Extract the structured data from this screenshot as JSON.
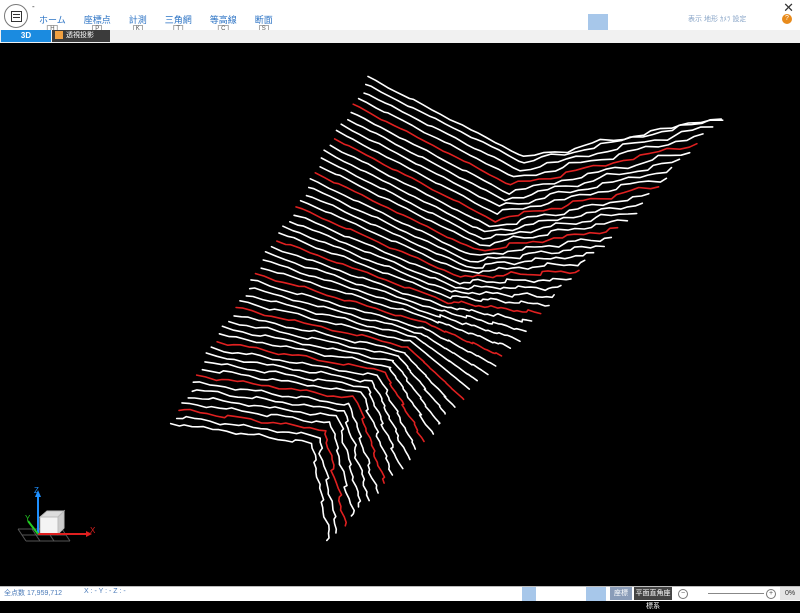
{
  "titlebar": {
    "qat_text": "-",
    "close_glyph": "✕",
    "tabs": [
      {
        "label": "ホーム",
        "key": "H"
      },
      {
        "label": "座標点",
        "key": "P"
      },
      {
        "label": "計測",
        "key": "K"
      },
      {
        "label": "三角網",
        "key": "T"
      },
      {
        "label": "等高線",
        "key": "C"
      },
      {
        "label": "断面",
        "key": "S"
      }
    ],
    "right_text": "表示 地形 ｶﾒﾗ 設定",
    "help_glyph": "?"
  },
  "view_tabs": {
    "tab_3d": "3D",
    "tab_perspective": "透視投影"
  },
  "axes": {
    "x": "X",
    "y": "Y",
    "z": "Z"
  },
  "status": {
    "point_count_label": "全点数",
    "point_count_value": "17,959,712",
    "xyz_readout": "X : - Y : - Z : -",
    "coord_label": "座標",
    "coord_button": "平面直角座標系",
    "zoom_minus": "−",
    "zoom_plus": "+",
    "percent": "0%"
  },
  "colors": {
    "accent_blue": "#1b8be0",
    "contour_white": "#ffffff",
    "contour_red": "#e02020"
  }
}
